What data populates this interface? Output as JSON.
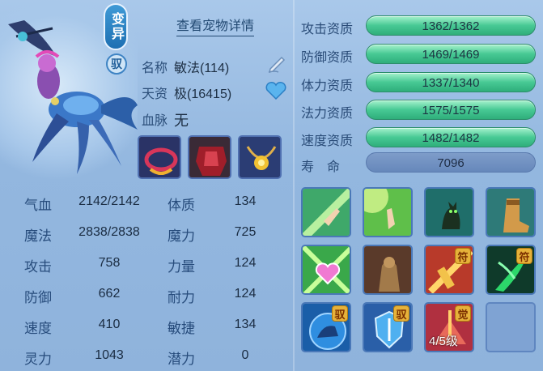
{
  "header": {
    "detail_link": "查看宠物详情",
    "variant_badge": "变异",
    "mount_badge": "驭"
  },
  "pet_info": {
    "name_label": "名称",
    "name_value": "敏法(114)",
    "talent_label": "天资",
    "talent_value": "极(16415)",
    "bloodline_label": "血脉",
    "bloodline_value": "无"
  },
  "equipment": [
    {
      "icon": "collar-icon"
    },
    {
      "icon": "armor-icon"
    },
    {
      "icon": "amulet-icon"
    }
  ],
  "stats": [
    {
      "label": "气血",
      "value": "2142/2142"
    },
    {
      "label": "魔法",
      "value": "2838/2838"
    },
    {
      "label": "攻击",
      "value": "758"
    },
    {
      "label": "防御",
      "value": "662"
    },
    {
      "label": "速度",
      "value": "410"
    },
    {
      "label": "灵力",
      "value": "1043"
    }
  ],
  "attributes": [
    {
      "label": "体质",
      "value": "134"
    },
    {
      "label": "魔力",
      "value": "725"
    },
    {
      "label": "力量",
      "value": "124"
    },
    {
      "label": "耐力",
      "value": "124"
    },
    {
      "label": "敏捷",
      "value": "134"
    },
    {
      "label": "潜力",
      "value": "0"
    }
  ],
  "aptitudes": [
    {
      "label": "攻击资质",
      "value": "1362/1362"
    },
    {
      "label": "防御资质",
      "value": "1469/1469"
    },
    {
      "label": "体力资质",
      "value": "1337/1340"
    },
    {
      "label": "法力资质",
      "value": "1575/1575"
    },
    {
      "label": "速度资质",
      "value": "1482/1482"
    }
  ],
  "lifespan": {
    "label": "寿　命",
    "value": "7096"
  },
  "skills": [
    {
      "icon": "finger-point-icon"
    },
    {
      "icon": "open-palm-icon"
    },
    {
      "icon": "cat-icon"
    },
    {
      "icon": "boot-icon"
    },
    {
      "icon": "heart-burst-icon"
    },
    {
      "icon": "stone-figure-icon"
    },
    {
      "icon": "talisman-icon",
      "tag": "符"
    },
    {
      "icon": "green-claw-icon",
      "tag": "符"
    },
    {
      "icon": "blue-beast-icon",
      "tag": "驭"
    },
    {
      "icon": "shield-icon",
      "tag": "驭"
    },
    {
      "icon": "awaken-icon",
      "tag": "觉",
      "level": "4/5级"
    },
    {
      "icon": "empty-slot"
    }
  ],
  "colors": {
    "bar_green": "#47c994",
    "life_bar": "#6688bb",
    "tag_gold": "#e6b23a"
  }
}
